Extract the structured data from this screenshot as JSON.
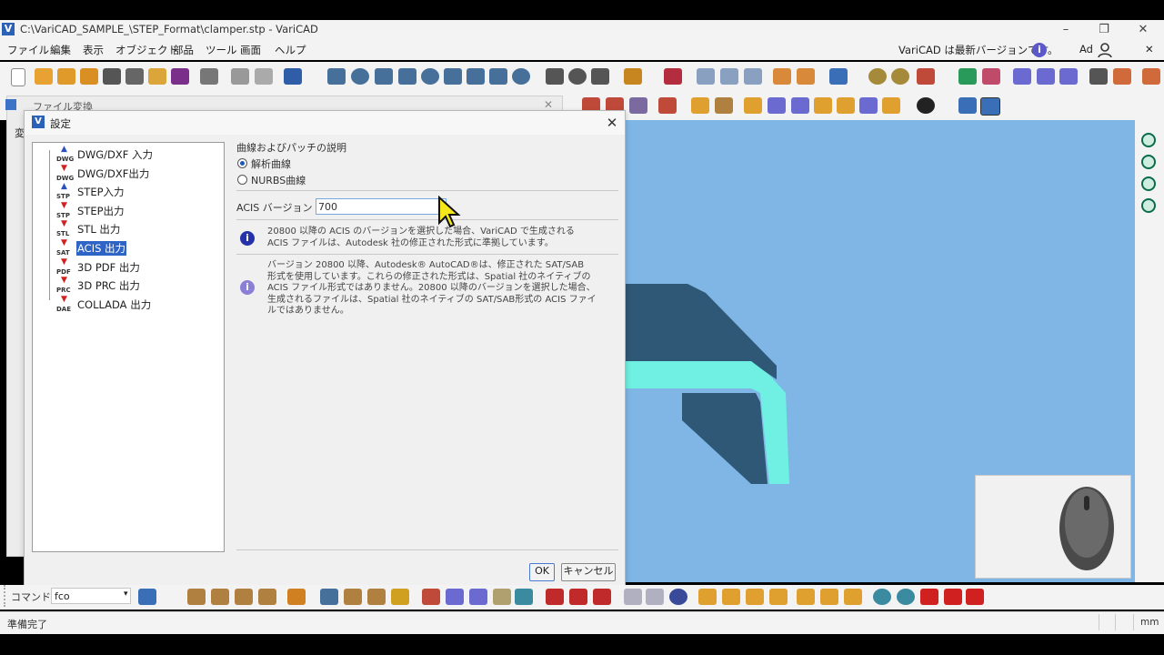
{
  "window": {
    "title": "C:\\VariCAD_SAMPLE_\\STEP_Format\\clamper.stp - VariCAD",
    "app_icon": "V",
    "minimize": "–",
    "restore": "❐",
    "close": "✕"
  },
  "menu": {
    "items": [
      "ファイル",
      "編集",
      "表示",
      "オブジェクト",
      "部品",
      "ツール",
      "画面",
      "ヘルプ"
    ],
    "update_notice": "VariCAD は最新バージョンです。",
    "user": "Ad",
    "close": "✕"
  },
  "back_dialog": {
    "title": "ファイル変換",
    "side_char": "変"
  },
  "dialog": {
    "title": "設定",
    "tree": [
      {
        "label": "DWG/DXF 入力",
        "fmt": "DWG",
        "dir": "in"
      },
      {
        "label": "DWG/DXF出力",
        "fmt": "DWG",
        "dir": "out"
      },
      {
        "label": "STEP入力",
        "fmt": "STP",
        "dir": "in"
      },
      {
        "label": "STEP出力",
        "fmt": "STP",
        "dir": "out"
      },
      {
        "label": "STL 出力",
        "fmt": "STL",
        "dir": "out"
      },
      {
        "label": "ACIS 出力",
        "fmt": "SAT",
        "dir": "out",
        "selected": true
      },
      {
        "label": "3D PDF 出力",
        "fmt": "PDF",
        "dir": "out"
      },
      {
        "label": "3D PRC 出力",
        "fmt": "PRC",
        "dir": "out"
      },
      {
        "label": "COLLADA 出力",
        "fmt": "DAE",
        "dir": "out"
      }
    ],
    "curve_group_label": "曲線およびパッチの説明",
    "radio_analytic": "解析曲線",
    "radio_nurbs": "NURBS曲線",
    "acis_version_label": "ACIS バージョン",
    "acis_version_value": "700",
    "info1": "20800 以降の ACIS のバージョンを選択した場合、VariCAD で生成される\nACIS ファイルは、Autodesk 社の修正された形式に準拠しています。",
    "info2": "バージョン 20800 以降、Autodesk® AutoCAD®は、修正された SAT/SAB\n形式を使用しています。これらの修正された形式は、Spatial 社のネイティブの\nACIS ファイル形式ではありません。20800 以降のバージョンを選択した場合、\n生成されるファイルは、Spatial 社のネイティブの SAT/SAB形式の ACIS ファイ\nルではありません。",
    "ok": "OK",
    "cancel": "キャンセル",
    "close": "✕"
  },
  "command": {
    "label": "コマンド:",
    "value": "fco"
  },
  "status": {
    "text": "準備完了",
    "units": "mm"
  },
  "colors": {
    "viewport": "#7fb6e6",
    "part_dark": "#2e5876",
    "part_light": "#6ff0e2",
    "selection": "#2e64c5"
  }
}
